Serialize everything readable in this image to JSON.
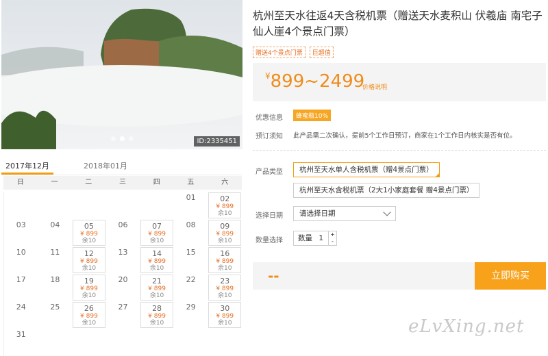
{
  "photo": {
    "id_label": "ID:2335451"
  },
  "calendar": {
    "months": [
      "2017年12月",
      "2018年01月"
    ],
    "weekdays": [
      "日",
      "一",
      "二",
      "三",
      "四",
      "五",
      "六"
    ],
    "days": [
      {
        "d": "",
        "p": "",
        "r": ""
      },
      {
        "d": "",
        "p": "",
        "r": ""
      },
      {
        "d": "",
        "p": "",
        "r": ""
      },
      {
        "d": "",
        "p": "",
        "r": ""
      },
      {
        "d": "",
        "p": "",
        "r": ""
      },
      {
        "d": "01",
        "p": "",
        "r": ""
      },
      {
        "d": "02",
        "p": "¥ 899",
        "r": "余10"
      },
      {
        "d": "03",
        "p": "",
        "r": ""
      },
      {
        "d": "04",
        "p": "",
        "r": ""
      },
      {
        "d": "05",
        "p": "¥ 899",
        "r": "余10"
      },
      {
        "d": "06",
        "p": "",
        "r": ""
      },
      {
        "d": "07",
        "p": "¥ 899",
        "r": "余10"
      },
      {
        "d": "08",
        "p": "",
        "r": ""
      },
      {
        "d": "09",
        "p": "¥ 899",
        "r": "余10"
      },
      {
        "d": "10",
        "p": "",
        "r": ""
      },
      {
        "d": "11",
        "p": "",
        "r": ""
      },
      {
        "d": "12",
        "p": "¥ 899",
        "r": "余10"
      },
      {
        "d": "13",
        "p": "",
        "r": ""
      },
      {
        "d": "14",
        "p": "¥ 899",
        "r": "余10"
      },
      {
        "d": "15",
        "p": "",
        "r": ""
      },
      {
        "d": "16",
        "p": "¥ 899",
        "r": "余10"
      },
      {
        "d": "17",
        "p": "",
        "r": ""
      },
      {
        "d": "18",
        "p": "",
        "r": ""
      },
      {
        "d": "19",
        "p": "¥ 899",
        "r": "余10"
      },
      {
        "d": "20",
        "p": "",
        "r": ""
      },
      {
        "d": "21",
        "p": "¥ 899",
        "r": "余10"
      },
      {
        "d": "22",
        "p": "",
        "r": ""
      },
      {
        "d": "23",
        "p": "¥ 899",
        "r": "余10"
      },
      {
        "d": "24",
        "p": "",
        "r": ""
      },
      {
        "d": "25",
        "p": "",
        "r": ""
      },
      {
        "d": "26",
        "p": "¥ 899",
        "r": "余10"
      },
      {
        "d": "27",
        "p": "",
        "r": ""
      },
      {
        "d": "28",
        "p": "¥ 899",
        "r": "余10"
      },
      {
        "d": "29",
        "p": "",
        "r": ""
      },
      {
        "d": "30",
        "p": "¥ 899",
        "r": "余10"
      },
      {
        "d": "31",
        "p": "",
        "r": ""
      }
    ]
  },
  "product": {
    "title": "杭州至天水往返4天含税机票（赠送天水麦积山 伏羲庙 南宅子 仙人崖4个景点门票）",
    "tags": [
      "赠送4个景点门票",
      "巨超值"
    ],
    "price_currency": "¥",
    "price_range": "899~2499",
    "price_note": "价格说明"
  },
  "info": {
    "promo_label": "优惠信息",
    "promo_badge": "蜂蜜瓶10%",
    "notice_label": "预订须知",
    "notice_text": "此产品需二次确认，提前5个工作日预订，商家在1个工作日内核实是否有位。"
  },
  "options": {
    "type_label": "产品类型",
    "type_options": [
      "杭州至天水单人含税机票（赠4景点门票）",
      "杭州至天水含税机票（2大1小家庭套餐 赠4景点门票）"
    ],
    "date_label": "选择日期",
    "date_placeholder": "请选择日期",
    "qty_label": "数量选择",
    "qty_text": "数量",
    "qty_value": "1",
    "qty_plus": "+",
    "qty_minus": "-"
  },
  "buy": {
    "total": "--",
    "button": "立即购买"
  },
  "watermark": "eLvXing.net",
  "colors": {
    "accent": "#f8a11b",
    "price": "#f08c1a"
  }
}
